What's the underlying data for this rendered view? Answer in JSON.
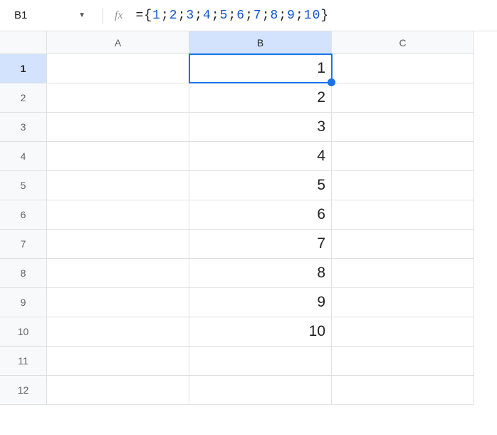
{
  "nameBox": "B1",
  "fxLabel": "fx",
  "formula": {
    "prefix": "={",
    "numbers": [
      "1",
      "2",
      "3",
      "4",
      "5",
      "6",
      "7",
      "8",
      "9",
      "10"
    ],
    "sep": ";",
    "suffix": "}"
  },
  "columns": [
    "A",
    "B",
    "C"
  ],
  "rowHeaders": [
    "1",
    "2",
    "3",
    "4",
    "5",
    "6",
    "7",
    "8",
    "9",
    "10",
    "11",
    "12"
  ],
  "activeCell": "B1",
  "selectedColumn": "B",
  "selectedRow": "1",
  "cells": {
    "B1": "1",
    "B2": "2",
    "B3": "3",
    "B4": "4",
    "B5": "5",
    "B6": "6",
    "B7": "7",
    "B8": "8",
    "B9": "9",
    "B10": "10"
  }
}
